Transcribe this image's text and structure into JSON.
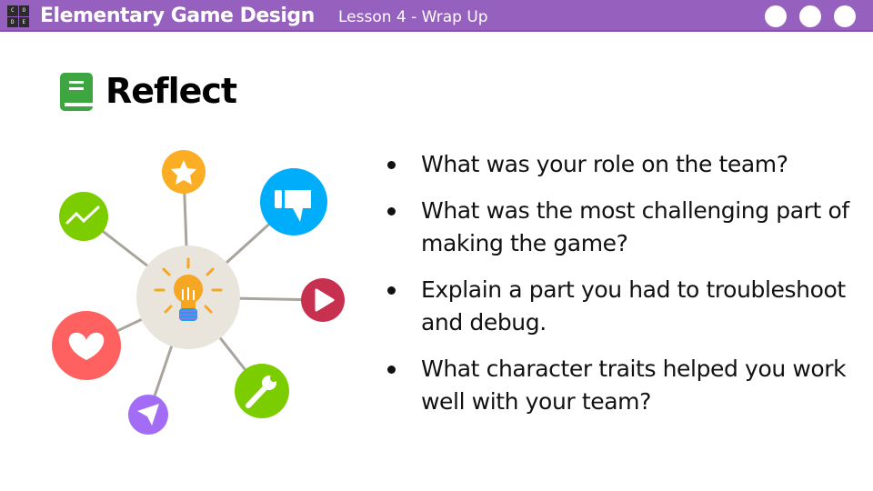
{
  "header": {
    "logo_letters": [
      "C",
      "O",
      "D",
      "E"
    ],
    "course_title": "Elementary Game Design",
    "lesson": "Lesson 4 - Wrap Up"
  },
  "slide": {
    "title": "Reflect",
    "icon": "book-icon",
    "questions": [
      "What was your role on the team?",
      "What was the most challenging part of making the game?",
      "Explain a part you had to troubleshoot and debug.",
      "What character traits helped you work well with your team?"
    ]
  },
  "colors": {
    "header": "#9660bf",
    "book": "#3ea641",
    "hub": "#e9e5dc"
  }
}
